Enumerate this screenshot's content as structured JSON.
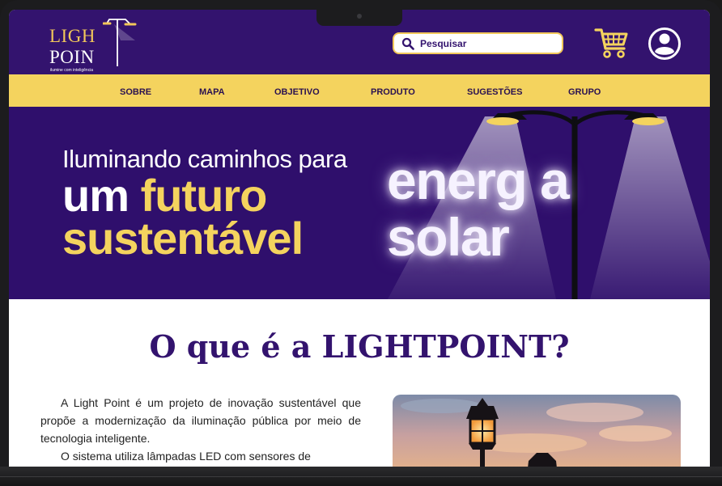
{
  "brand": {
    "logo_line1": "LIGH",
    "logo_line2": "POIN",
    "logo_tagline": "ilumine com inteligência"
  },
  "search": {
    "placeholder": "Pesquisar"
  },
  "nav": {
    "items": [
      "SOBRE",
      "MAPA",
      "OBJETIVO",
      "PRODUTO",
      "SUGESTÕES",
      "GRUPO"
    ]
  },
  "hero": {
    "line1": "Iluminando caminhos para",
    "line2_white": "um ",
    "line2_accent": "futuro",
    "line3": "sustentável",
    "glow_line1": "energ a",
    "glow_line2": "solar"
  },
  "about": {
    "title": "O que é a LIGHTPOINT?",
    "paragraph1": "A Light Point é um projeto de inovação sustentável que propõe a modernização da iluminação pública por meio de tecnologia inteligente.",
    "paragraph2": "O sistema utiliza lâmpadas LED com sensores de"
  },
  "colors": {
    "brand_purple": "#33136e",
    "hero_purple": "#2f0f6c",
    "accent_yellow": "#f4d35e"
  },
  "icons": [
    "search-icon",
    "cart-icon",
    "user-icon",
    "street-lamp-icon"
  ]
}
